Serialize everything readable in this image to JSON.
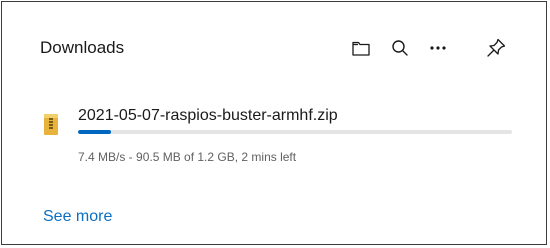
{
  "header": {
    "title": "Downloads",
    "icons": [
      "folder-icon",
      "search-icon",
      "more-icon",
      "pin-icon"
    ]
  },
  "download": {
    "file_name": "2021-05-07-raspios-buster-armhf.zip",
    "file_icon": "zip-folder-icon",
    "status": "7.4 MB/s - 90.5 MB of 1.2 GB, 2 mins left",
    "progress": 0.075
  },
  "footer": {
    "see_more_label": "See more"
  },
  "colors": {
    "accent": "#0067c0",
    "link": "#0a6fc2",
    "track": "#e4e4e4",
    "border": "#3c3c3c"
  }
}
